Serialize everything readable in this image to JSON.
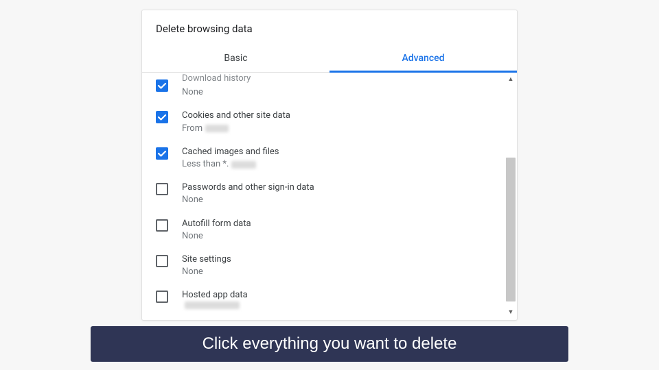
{
  "dialog": {
    "title": "Delete browsing data",
    "tabs": {
      "basic": "Basic",
      "advanced": "Advanced"
    },
    "items": [
      {
        "label": "Download history",
        "sub": "None",
        "checked": true,
        "cutoff": true,
        "blurWidth": 0
      },
      {
        "label": "Cookies and other site data",
        "sub": "From",
        "checked": true,
        "blurWidth": 34
      },
      {
        "label": "Cached images and files",
        "sub": "Less than *.",
        "checked": true,
        "blurWidth": 36
      },
      {
        "label": "Passwords and other sign-in data",
        "sub": "None",
        "checked": false,
        "blurWidth": 0
      },
      {
        "label": "Autofill form data",
        "sub": "None",
        "checked": false,
        "blurWidth": 0
      },
      {
        "label": "Site settings",
        "sub": "None",
        "checked": false,
        "blurWidth": 0
      },
      {
        "label": "Hosted app data",
        "sub": "",
        "checked": false,
        "blurWidth": 80
      }
    ]
  },
  "caption": "Click everything you want to delete"
}
